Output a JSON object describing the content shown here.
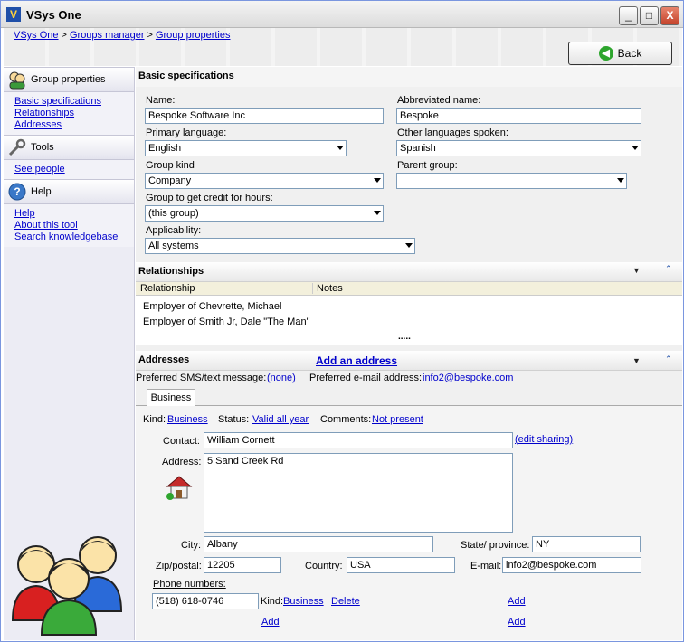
{
  "window": {
    "title": "VSys One",
    "min_label": "_",
    "max_label": "□",
    "close_label": "X"
  },
  "breadcrumb": {
    "items": [
      "VSys One",
      "Groups manager",
      "Group properties"
    ],
    "separator": ">"
  },
  "back_label": "Back",
  "sidebar": {
    "group_properties": {
      "title": "Group properties",
      "links": [
        "Basic specifications",
        "Relationships",
        "Addresses"
      ]
    },
    "tools": {
      "title": "Tools",
      "links": [
        "See people"
      ]
    },
    "help": {
      "title": "Help",
      "links": [
        "Help",
        "About this tool",
        "Search knowledgebase"
      ]
    }
  },
  "basic": {
    "title": "Basic specifications",
    "name_label": "Name:",
    "name_value": "Bespoke Software Inc",
    "abbr_label": "Abbreviated name:",
    "abbr_value": "Bespoke",
    "primary_lang_label": "Primary language:",
    "primary_lang_value": "English",
    "other_lang_label": "Other languages spoken:",
    "other_lang_value": "Spanish",
    "kind_label": "Group kind",
    "kind_value": "Company",
    "parent_label": "Parent group:",
    "parent_value": "",
    "credit_label": "Group to get credit for hours:",
    "credit_value": "(this group)",
    "applicability_label": "Applicability:",
    "applicability_value": "All systems"
  },
  "relationships": {
    "title": "Relationships",
    "columns": [
      "Relationship",
      "Notes"
    ],
    "rows": [
      "Employer of Chevrette, Michael",
      "Employer of Smith Jr, Dale \"The Man\""
    ],
    "more": "....."
  },
  "addresses": {
    "title": "Addresses",
    "add_label": "Add an address",
    "pref_sms_label": "Preferred SMS/text message:",
    "pref_sms_value": "(none)",
    "pref_email_label": "Preferred e-mail address:",
    "pref_email_value": "info2@bespoke.com",
    "tab": "Business",
    "kind_label": "Kind:",
    "kind_value": "Business",
    "status_label": "Status:",
    "status_value": "Valid all year",
    "comments_label": "Comments:",
    "comments_value": "Not present",
    "contact_label": "Contact:",
    "contact_value": "William Cornett",
    "edit_sharing": "(edit sharing)",
    "address_label": "Address:",
    "address_value": "5 Sand Creek Rd",
    "city_label": "City:",
    "city_value": "Albany",
    "state_label": "State/ province:",
    "state_value": "NY",
    "zip_label": "Zip/postal:",
    "zip_value": "12205",
    "country_label": "Country:",
    "country_value": "USA",
    "email_label": "E-mail:",
    "email_value": "info2@bespoke.com",
    "phone_label": "Phone numbers:",
    "phone_value": "(518) 618-0746",
    "phone_kind_label": "Kind:",
    "phone_kind_value": "Business",
    "delete_label": "Delete",
    "add": "Add"
  }
}
